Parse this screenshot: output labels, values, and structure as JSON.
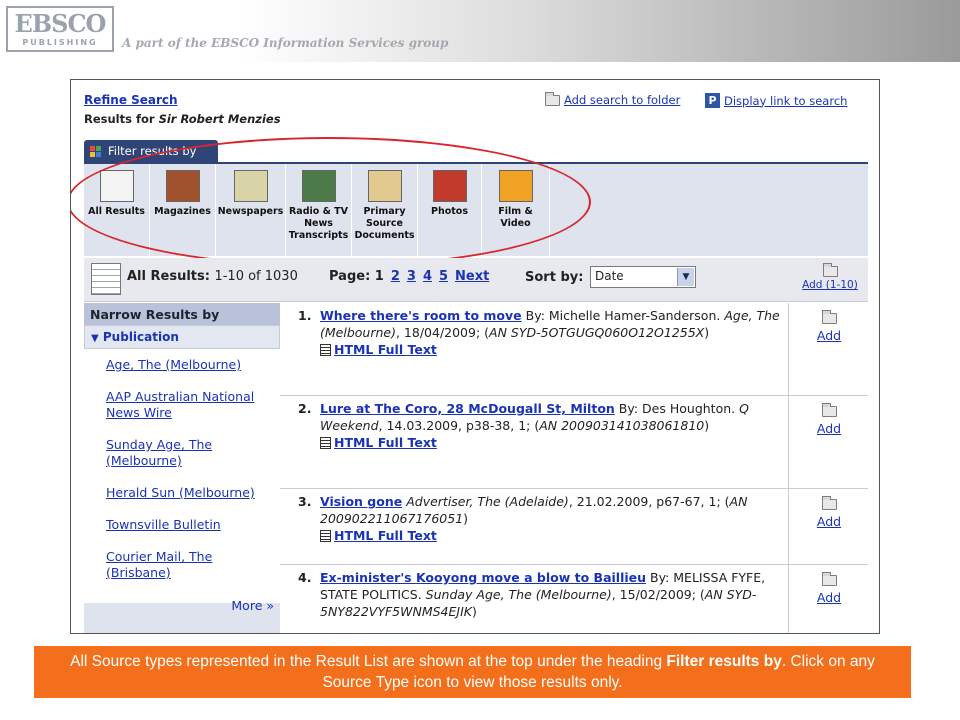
{
  "header": {
    "logo_main": "EBSCO",
    "logo_sub": "PUBLISHING",
    "tagline": "A part of the EBSCO Information Services group"
  },
  "top": {
    "refine_search": "Refine Search",
    "results_for_label": "Results for",
    "query": "Sir Robert Menzies",
    "add_search_folder": "Add search to folder",
    "display_link": "Display link to search"
  },
  "filter": {
    "tab_label": "Filter results by",
    "sources": [
      {
        "label": "All Results",
        "color": "#f3f3f3"
      },
      {
        "label": "Magazines",
        "color": "#a0522d"
      },
      {
        "label": "Newspapers",
        "color": "#d9d3a8"
      },
      {
        "label": "Radio & TV News Transcripts",
        "color": "#4d7a49"
      },
      {
        "label": "Primary Source Documents",
        "color": "#e2c98f"
      },
      {
        "label": "Photos",
        "color": "#c23a2b"
      },
      {
        "label": "Film & Video",
        "color": "#f0a225"
      }
    ]
  },
  "results_bar": {
    "all_results_label": "All Results:",
    "range_text": "1-10 of 1030",
    "page_label": "Page: 1",
    "pages": [
      "2",
      "3",
      "4",
      "5"
    ],
    "next": "Next",
    "sort_label": "Sort by:",
    "sort_value": "Date",
    "add_range": "Add (1-10)"
  },
  "narrow": {
    "heading": "Narrow Results by",
    "section": "Publication",
    "items": [
      "Age, The (Melbourne)",
      "AAP Australian National News Wire",
      "Sunday Age, The (Melbourne)",
      "Herald Sun (Melbourne)",
      "Townsville Bulletin",
      "Courier Mail, The (Brisbane)"
    ],
    "more": "More »"
  },
  "results": [
    {
      "num": "1.",
      "title": "Where there's room to move",
      "by": "By: Michelle Hamer-Sanderson.",
      "pub": "Age, The (Melbourne)",
      "details": ", 18/04/2009; (",
      "an": "AN SYD-5OTGUGQ060O12O1255X",
      "tail": ")",
      "fulltext": "HTML Full Text",
      "add": "Add"
    },
    {
      "num": "2.",
      "title": "Lure at The Coro, 28 McDougall St, Milton",
      "by": "By: Des Houghton.",
      "pub": "Q Weekend",
      "details": ", 14.03.2009, p38-38, 1; (",
      "an": "AN 200903141038061810",
      "tail": ")",
      "fulltext": "HTML Full Text",
      "add": "Add"
    },
    {
      "num": "3.",
      "title": "Vision gone",
      "by": "",
      "pub": "Advertiser, The (Adelaide)",
      "details": ", 21.02.2009, p67-67, 1; (",
      "an": "AN 200902211067176051",
      "tail": ")",
      "fulltext": "HTML Full Text",
      "add": "Add"
    },
    {
      "num": "4.",
      "title": "Ex-minister's Kooyong move a blow to Baillieu",
      "by": "By: MELISSA FYFE, STATE POLITICS.",
      "pub": "Sunday Age, The (Melbourne)",
      "details": ", 15/02/2009; (",
      "an": "AN SYD-5NY822VYF5WNMS4EJIK",
      "tail": ")",
      "fulltext": "",
      "add": "Add"
    }
  ],
  "caption": {
    "text_before": "All Source types represented in the Result List are shown at the top under the heading ",
    "bold": "Filter results by",
    "text_after": ". Click on any Source Type icon to view those results only."
  }
}
